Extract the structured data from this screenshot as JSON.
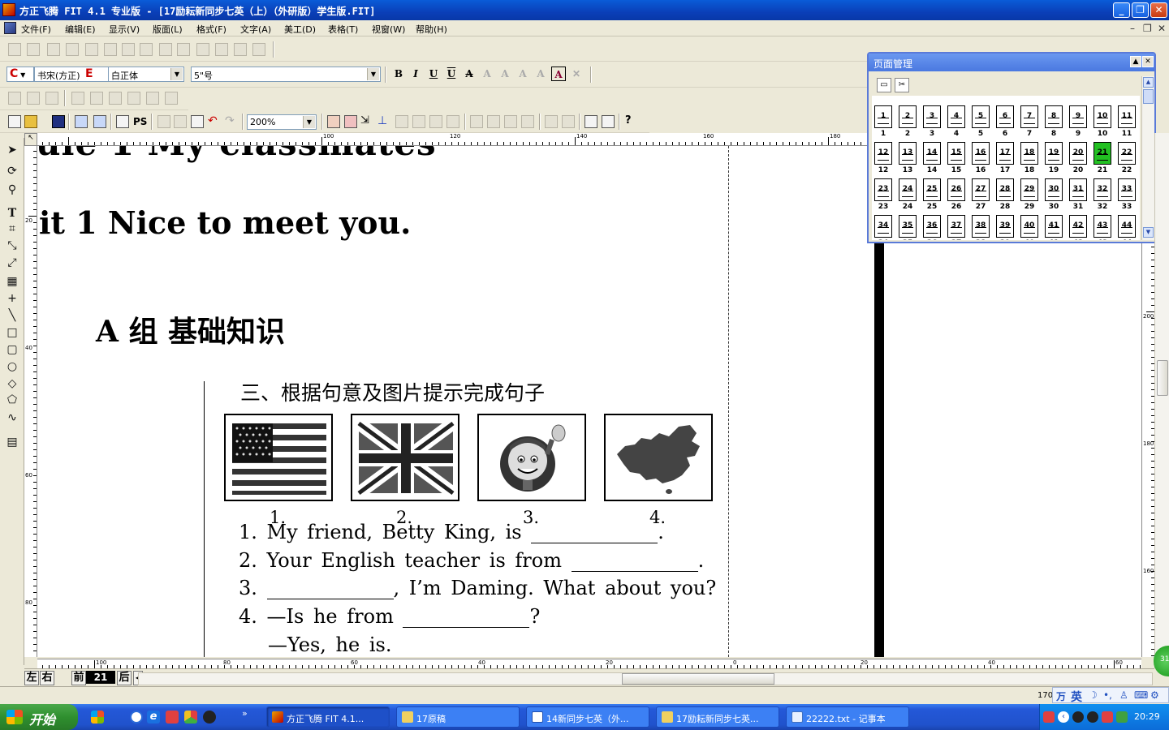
{
  "window": {
    "title": "方正飞腾 FIT 4.1 专业版 - [17励耘新同步七英（上）（外研版）学生版.FIT]",
    "controls": [
      "_",
      "❐",
      "✕"
    ]
  },
  "menu": {
    "items": [
      "文件(F)",
      "编辑(E)",
      "显示(V)",
      "版面(L)",
      "格式(F)",
      "文字(A)",
      "美工(D)",
      "表格(T)",
      "视窗(W)",
      "帮助(H)"
    ],
    "mdi_controls": [
      "–",
      "❐",
      "✕"
    ]
  },
  "format_toolbar": {
    "font_chinese": "书宋(方正)",
    "font_english": "白正体",
    "font_size": "5\"号",
    "lang_c": "C",
    "lang_e": "E"
  },
  "standard_toolbar": {
    "zoom": "200%",
    "ps_label": "PS"
  },
  "rulers": {
    "top_labels": [
      "100",
      "120",
      "140",
      "160",
      "180"
    ],
    "left_labels": [
      "20",
      "40",
      "60",
      "80"
    ],
    "right_labels": [
      "200",
      "180",
      "160"
    ],
    "bottom_labels": [
      "100",
      "80",
      "60",
      "40",
      "20",
      "0",
      "20",
      "40",
      "60"
    ],
    "corner": "↖"
  },
  "document": {
    "module_title": "ule 1   My  classmates",
    "unit_title": "it 1    Nice  to  meet  you.",
    "section_a": "A 组   基础知识",
    "exercise_title": "三、根据句意及图片提示完成句子",
    "pictures": [
      {
        "num": "1.",
        "icon": "usa-flag-icon"
      },
      {
        "num": "2.",
        "icon": "uk-flag-icon"
      },
      {
        "num": "3.",
        "icon": "cartoon-man-icon"
      },
      {
        "num": "4.",
        "icon": "china-map-icon"
      }
    ],
    "questions": [
      {
        "num": "1.",
        "before": "My  friend,  Betty  King,  is",
        "after": "."
      },
      {
        "num": "2.",
        "before": "Your  English  teacher  is  from",
        "after": "."
      },
      {
        "num": "3.",
        "before": "",
        "after": ",  I’m  Daming.  What  about  you?"
      },
      {
        "num": "4.",
        "before": "—Is  he  from",
        "after": "?"
      }
    ],
    "answer_line": "—Yes,  he  is."
  },
  "page_bar": {
    "left": "左",
    "right": "右",
    "prev": "前",
    "current": "21",
    "next": "后"
  },
  "status": {
    "coord": "170",
    "ime_lang": "英"
  },
  "page_manager": {
    "title": "页面管理",
    "pages": [
      "1",
      "2",
      "3",
      "4",
      "5",
      "6",
      "7",
      "8",
      "9",
      "10",
      "11",
      "12",
      "13",
      "14",
      "15",
      "16",
      "17",
      "18",
      "19",
      "20",
      "21",
      "22",
      "23",
      "24",
      "25",
      "26",
      "27",
      "28",
      "29",
      "30",
      "31",
      "32",
      "33",
      "34",
      "35",
      "36",
      "37",
      "38",
      "39",
      "40",
      "41",
      "42",
      "43",
      "44"
    ],
    "selected": "21"
  },
  "taskbar": {
    "start": "开始",
    "tasks": [
      "方正飞腾 FIT 4.1...",
      "17原稿",
      "14新同步七英（外...",
      "17励耘新同步七英...",
      "22222.txt - 记事本"
    ],
    "clock": "20:29"
  },
  "badge": "31"
}
